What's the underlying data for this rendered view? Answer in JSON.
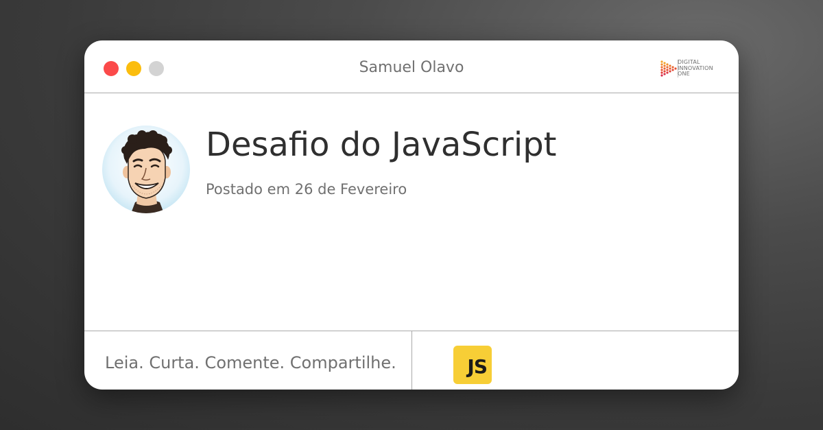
{
  "window": {
    "title": "Samuel Olavo"
  },
  "brand": {
    "logo_line1": "DIGITAL",
    "logo_line2": "INNOVATION",
    "logo_line3": "ONE"
  },
  "post": {
    "title": "Desafio do JavaScript",
    "date": "Postado em 26 de Fevereiro"
  },
  "footer": {
    "tagline": "Leia. Curta. Comente. Compartilhe.",
    "badge_label": "JS"
  },
  "colors": {
    "close": "#fb4a4a",
    "minimize": "#fbbd0e",
    "maximize": "#d3d3d3",
    "js_badge": "#f7ce36"
  }
}
